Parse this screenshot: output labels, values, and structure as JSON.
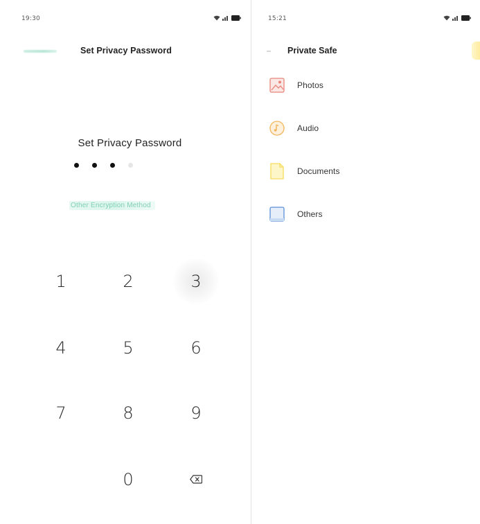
{
  "left_screen": {
    "status_time": "19:30",
    "title": "Set Privacy Password",
    "prompt": "Set Privacy Password",
    "entered_digits": 3,
    "total_digits": 4,
    "other_method_label": "Other Encryption Method",
    "keypad": [
      "1",
      "2",
      "3",
      "4",
      "5",
      "6",
      "7",
      "8",
      "9",
      "0"
    ],
    "delete_key_icon": "backspace-icon"
  },
  "right_screen": {
    "status_time": "15:21",
    "title": "Private Safe",
    "items": [
      {
        "label": "Photos",
        "icon": "photos-icon",
        "color": "#e8847a"
      },
      {
        "label": "Audio",
        "icon": "audio-icon",
        "color": "#f2b45a"
      },
      {
        "label": "Documents",
        "icon": "documents-icon",
        "color": "#f6dd5e"
      },
      {
        "label": "Others",
        "icon": "others-icon",
        "color": "#5b8fd6"
      }
    ]
  },
  "colors": {
    "accent": "#7fcfb3",
    "text": "#222222"
  }
}
